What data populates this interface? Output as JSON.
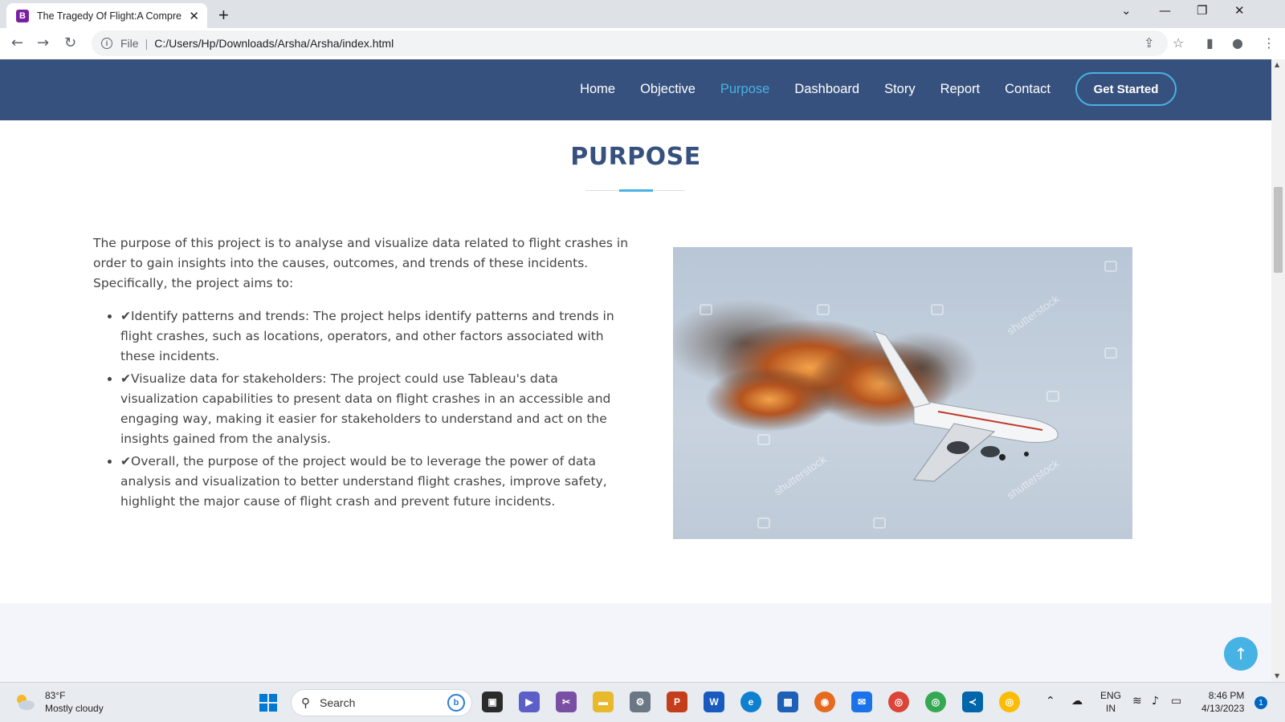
{
  "browser": {
    "tab_title": "The Tragedy Of Flight:A Compreh",
    "favicon_letter": "B",
    "url_scheme": "File",
    "url": "C:/Users/Hp/Downloads/Arsha/Arsha/index.html"
  },
  "nav": {
    "items": [
      "Home",
      "Objective",
      "Purpose",
      "Dashboard",
      "Story",
      "Report",
      "Contact"
    ],
    "active": "Purpose",
    "cta": "Get Started"
  },
  "section": {
    "title": "PURPOSE",
    "intro": "The purpose of this project is to analyse and visualize data related to flight crashes in order to gain insights into the causes, outcomes, and trends of these incidents. Specifically, the project aims to:",
    "bullets": [
      "✔Identify patterns and trends: The project helps identify patterns and trends in flight crashes, such as locations, operators, and other factors associated with these incidents.",
      "✔Visualize data for stakeholders: The project could use Tableau's data visualization capabilities to present data on flight crashes in an accessible and engaging way, making it easier for stakeholders to understand and act on the insights gained from the analysis.",
      "✔Overall, the purpose of the project would be to leverage the power of data analysis and visualization to better understand flight crashes, improve safety, highlight the major cause of flight crash and prevent future incidents."
    ],
    "image_watermark": "shutterstock"
  },
  "taskbar": {
    "weather_temp": "83°F",
    "weather_desc": "Mostly cloudy",
    "search_placeholder": "Search",
    "lang_primary": "ENG",
    "lang_secondary": "IN",
    "time": "8:46 PM",
    "date": "4/13/2023",
    "notification_count": "1"
  },
  "colors": {
    "header_bg": "#37517e",
    "accent": "#47b2e4",
    "section_band": "#f3f5fa"
  }
}
